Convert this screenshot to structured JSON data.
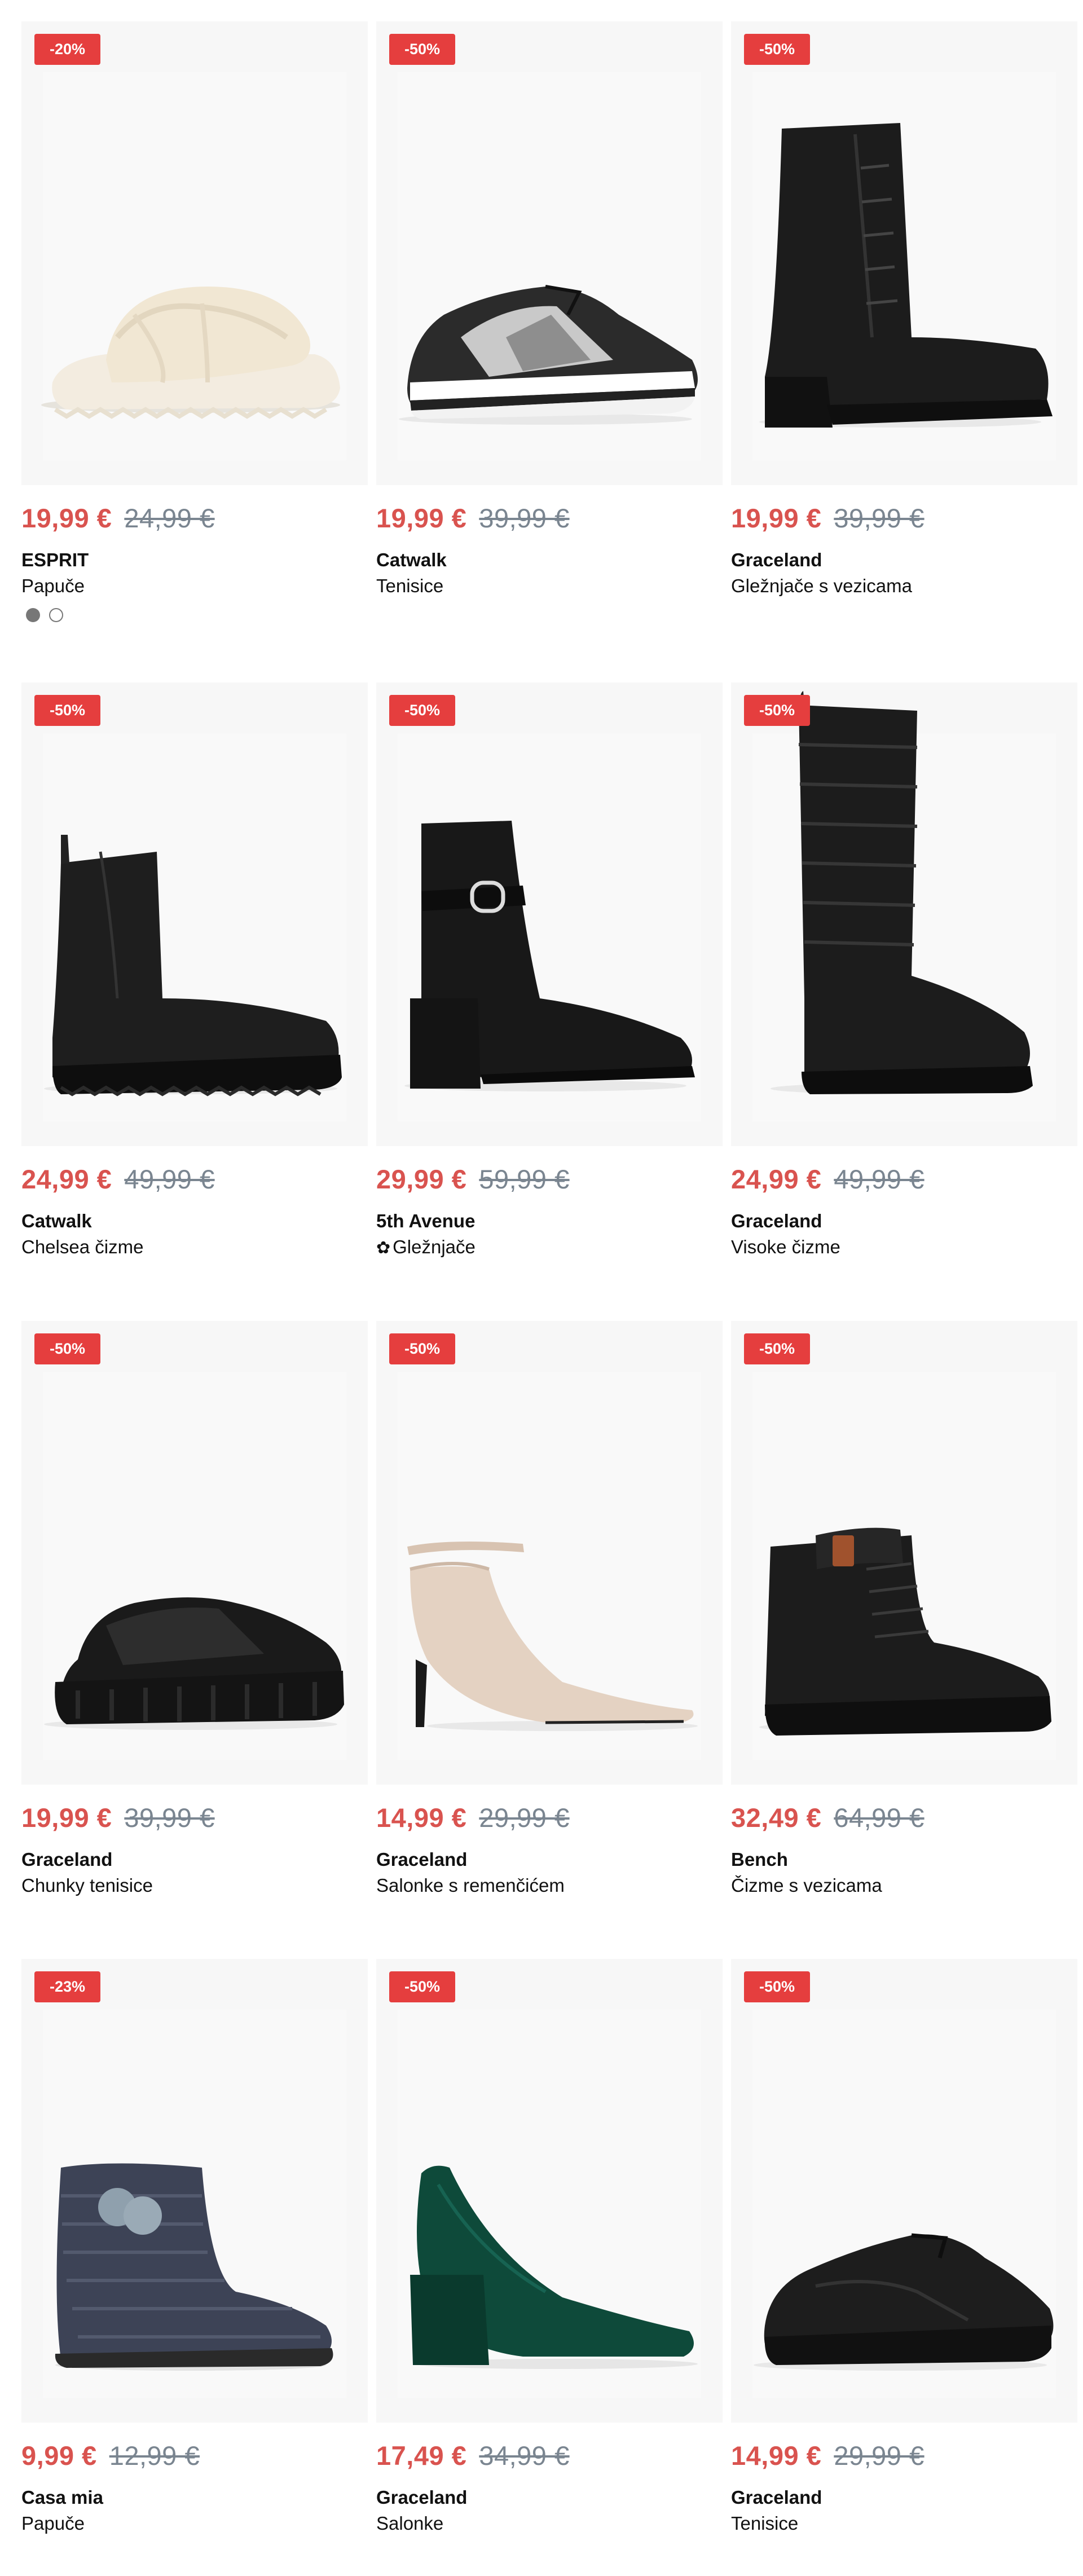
{
  "products": [
    {
      "badge": "-20%",
      "price_now": "19,99 €",
      "price_old": "24,99 €",
      "brand": "ESPRIT",
      "type": "Papuče",
      "icon": "fluffy-slipper",
      "swatches": [
        "filled",
        "empty"
      ]
    },
    {
      "badge": "-50%",
      "price_now": "19,99 €",
      "price_old": "39,99 €",
      "brand": "Catwalk",
      "type": "Tenisice",
      "icon": "silver-sneaker"
    },
    {
      "badge": "-50%",
      "price_now": "19,99 €",
      "price_old": "39,99 €",
      "brand": "Graceland",
      "type": "Gležnjače s vezicama",
      "icon": "lace-up-heeled-boot"
    },
    {
      "badge": "-50%",
      "price_now": "24,99 €",
      "price_old": "49,99 €",
      "brand": "Catwalk",
      "type": "Chelsea čizme",
      "icon": "chelsea-boot"
    },
    {
      "badge": "-50%",
      "price_now": "29,99 €",
      "price_old": "59,99 €",
      "brand": "5th Avenue",
      "type": "Gležnjače",
      "type_prefix": "✿",
      "icon": "buckle-ankle-boot"
    },
    {
      "badge": "-50%",
      "price_now": "24,99 €",
      "price_old": "49,99 €",
      "brand": "Graceland",
      "type": "Visoke čizme",
      "icon": "quilted-tall-boot"
    },
    {
      "badge": "-50%",
      "price_now": "19,99 €",
      "price_old": "39,99 €",
      "brand": "Graceland",
      "type": "Chunky tenisice",
      "icon": "chunky-glitter-sneaker"
    },
    {
      "badge": "-50%",
      "price_now": "14,99 €",
      "price_old": "29,99 €",
      "brand": "Graceland",
      "type": "Salonke s remenčićem",
      "icon": "ankle-strap-pump"
    },
    {
      "badge": "-50%",
      "price_now": "32,49 €",
      "price_old": "64,99 €",
      "brand": "Bench",
      "type": "Čizme s vezicama",
      "icon": "lace-up-combat-boot"
    },
    {
      "badge": "-23%",
      "price_now": "9,99 €",
      "price_old": "12,99 €",
      "brand": "Casa mia",
      "type": "Papuče",
      "icon": "knit-bootie-slipper"
    },
    {
      "badge": "-50%",
      "price_now": "17,49 €",
      "price_old": "34,99 €",
      "brand": "Graceland",
      "type": "Salonke",
      "icon": "green-velvet-pump"
    },
    {
      "badge": "-50%",
      "price_now": "14,99 €",
      "price_old": "29,99 €",
      "brand": "Graceland",
      "type": "Tenisice",
      "icon": "black-sneaker"
    }
  ],
  "colors": {
    "badge": "#e53e3e",
    "price_now": "#d9534f",
    "price_old": "#7a8590",
    "image_bg": "#f7f7f7"
  }
}
